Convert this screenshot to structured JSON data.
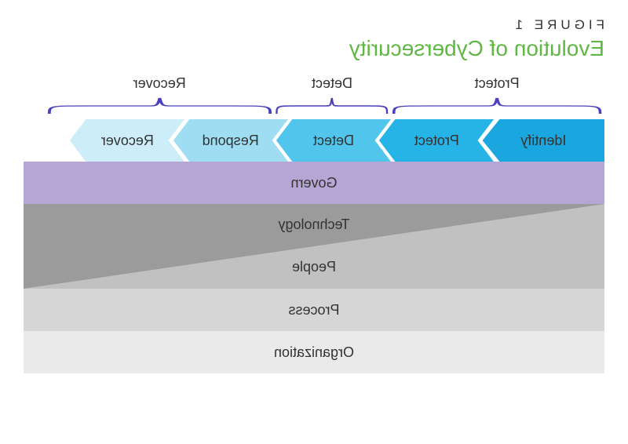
{
  "header": {
    "figure_label": "FIGURE 1",
    "title": "Evolution of Cybersecurity"
  },
  "braces": [
    {
      "label": "Protect",
      "start_pct": 0,
      "width_pct": 37
    },
    {
      "label": "Detect",
      "start_pct": 37,
      "width_pct": 19.8
    },
    {
      "label": "Recover",
      "start_pct": 56.8,
      "width_pct": 39.6
    }
  ],
  "arrows": [
    {
      "label": "Identify",
      "color": "#1aa7e0",
      "width_pct": 19.5
    },
    {
      "label": "Protect",
      "color": "#26b3e6",
      "width_pct": 19.5
    },
    {
      "label": "Detect",
      "color": "#52c5ec",
      "width_pct": 19.5
    },
    {
      "label": "Respond",
      "color": "#9fddf2",
      "width_pct": 19.5
    },
    {
      "label": "Recover",
      "color": "#cdeef9",
      "width_pct": 19.5
    }
  ],
  "bars": {
    "govern": "Govern",
    "technology": "Technology",
    "people": "People",
    "process": "Process",
    "organization": "Organization"
  },
  "colors": {
    "brace_stroke": "#4a3fbf",
    "title_green": "#5fb843",
    "govern_bg": "#b6a6d5",
    "tech_people_light": "#c1c1c1",
    "tech_people_dark": "#9b9b9b",
    "process_bg": "#d6d6d6",
    "org_bg": "#eaeaea"
  }
}
